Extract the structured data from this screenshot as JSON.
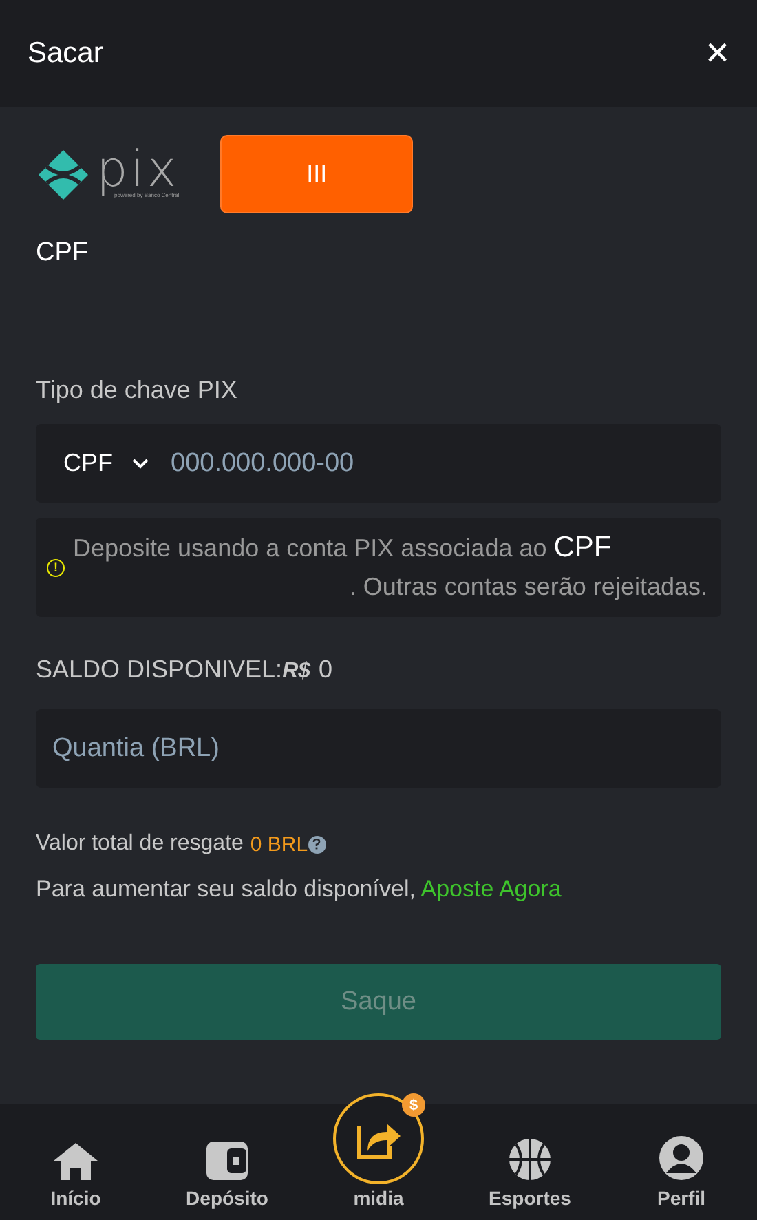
{
  "header": {
    "title": "Sacar",
    "close": "×"
  },
  "pix": {
    "wordmark": "pix",
    "tagline": "powered by Banco Central",
    "button": "III",
    "label": "CPF"
  },
  "key_type": {
    "label": "Tipo de chave PIX",
    "type": "CPF",
    "placeholder": "000.000.000-00"
  },
  "notice": {
    "icon": "!",
    "text": "Deposite usando a conta PIX associada ao",
    "highlight": "CPF",
    "text_end": ". Outras contas serão rejeitadas."
  },
  "balance": {
    "label": "SALDO DISPONIVEL:",
    "currency": "R$",
    "value": "0"
  },
  "amount": {
    "placeholder": "Quantia (BRL)"
  },
  "total": {
    "label": "Valor total de resgate",
    "value": "0 BRL"
  },
  "hint": {
    "text": "Para aumentar seu saldo disponível,",
    "link": "Aposte Agora"
  },
  "submit": {
    "label": "Saque",
    "disabled": true
  },
  "nav": [
    {
      "label": "Início",
      "kind": "home"
    },
    {
      "label": "Depósito",
      "kind": "wallet"
    },
    {
      "label": "midia",
      "kind": "share",
      "badge": "$"
    },
    {
      "label": "Esportes",
      "kind": "ball"
    },
    {
      "label": "Perfil",
      "kind": "user"
    }
  ]
}
